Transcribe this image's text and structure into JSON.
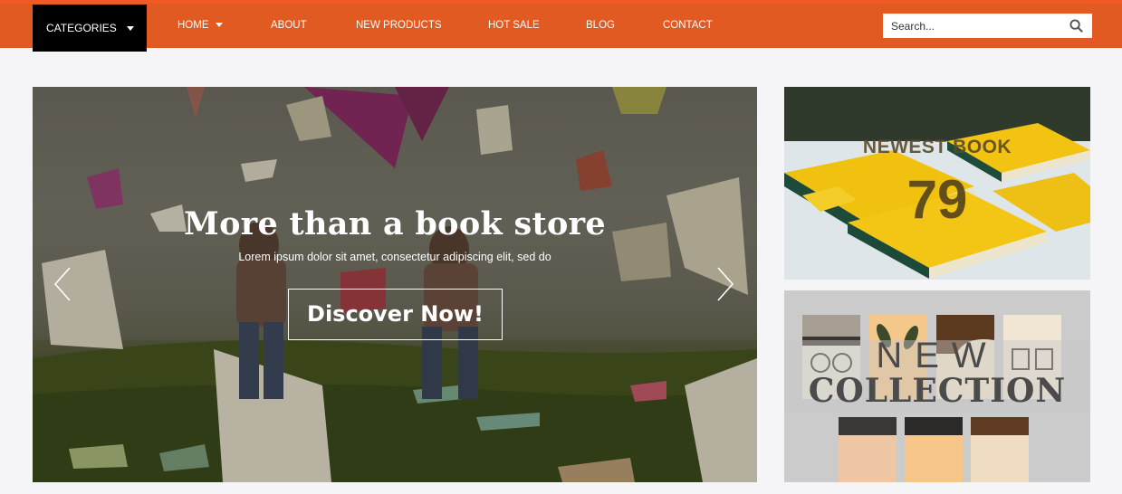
{
  "nav": {
    "categories_label": "CATEGORIES",
    "items": [
      {
        "label": "HOME",
        "has_dropdown": true
      },
      {
        "label": "ABOUT"
      },
      {
        "label": "NEW PRODUCTS"
      },
      {
        "label": "HOT SALE"
      },
      {
        "label": "BLOG"
      },
      {
        "label": "CONTACT"
      }
    ],
    "search_placeholder": "Search...",
    "search_icon": "search-icon",
    "colors": {
      "bar": "#e05a21",
      "categories_bg": "#000000"
    }
  },
  "hero": {
    "title": "More than a book store",
    "subtitle": "Lorem ipsum dolor sit amet, consectetur adipiscing elit, sed do",
    "button_label": "Discover Now!",
    "prev_icon": "chevron-left-icon",
    "next_icon": "chevron-right-icon"
  },
  "banners": [
    {
      "title": "NEWEST BOOK",
      "value": "79"
    },
    {
      "title": "NEW",
      "subtitle": "COLLECTION"
    }
  ]
}
